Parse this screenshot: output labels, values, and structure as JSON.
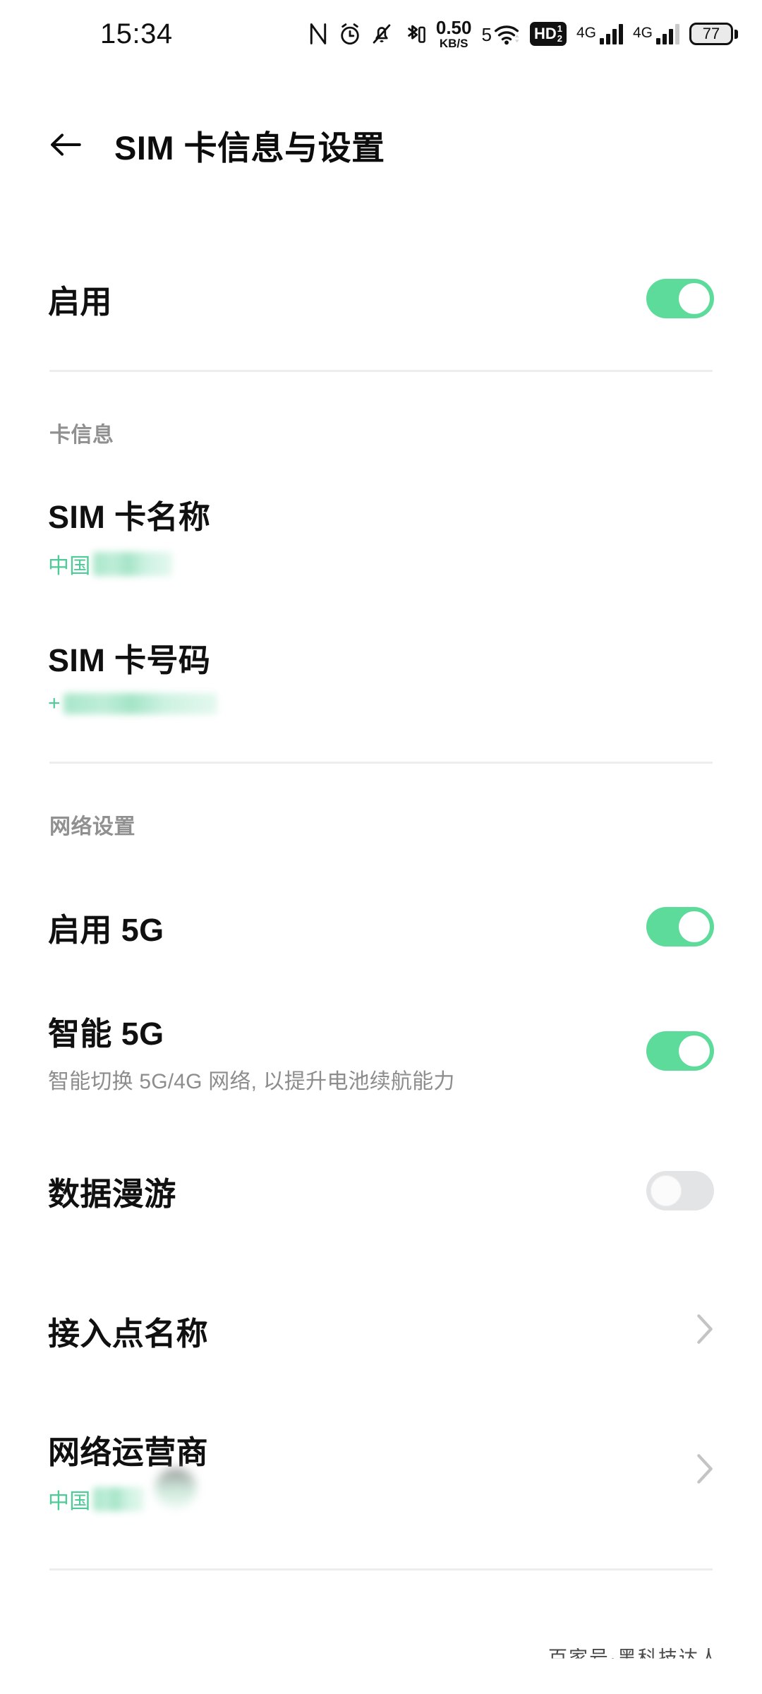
{
  "status_bar": {
    "time": "15:34",
    "icons": [
      "nfc-icon",
      "alarm-icon",
      "bell-off-icon",
      "bluetooth-icon"
    ],
    "net_speed_value": "0.50",
    "net_speed_unit": "KB/S",
    "wifi_label": "5",
    "volte_badge": "HD",
    "volte_sup": "1",
    "volte_sub": "2",
    "sim1_network": "4G",
    "sim2_network": "4G",
    "battery_level": "77"
  },
  "app_bar": {
    "back_icon": "arrow-left-icon",
    "title": "SIM 卡信息与设置"
  },
  "enable_row": {
    "title": "启用",
    "toggle_state": "on"
  },
  "card_info": {
    "section_label": "卡信息",
    "sim_name": {
      "title": "SIM 卡名称",
      "value_prefix": "中国",
      "value_redacted": true
    },
    "sim_number": {
      "title": "SIM 卡号码",
      "value_prefix": "+",
      "value_redacted": true
    }
  },
  "network_settings": {
    "section_label": "网络设置",
    "enable_5g": {
      "title": "启用 5G",
      "toggle_state": "on"
    },
    "smart_5g": {
      "title": "智能 5G",
      "subtitle": "智能切换 5G/4G 网络, 以提升电池续航能力",
      "toggle_state": "on"
    },
    "data_roaming": {
      "title": "数据漫游",
      "toggle_state": "off"
    },
    "apn": {
      "title": "接入点名称",
      "chevron_icon": "chevron-right-icon"
    },
    "carrier": {
      "title": "网络运营商",
      "value_prefix": "中国",
      "value_redacted": true,
      "chevron_icon": "chevron-right-icon"
    }
  },
  "watermark": {
    "text": "百家号·黑科技达人"
  },
  "colors": {
    "accent_green": "#5ddb9a",
    "subtitle_green": "#4ecb97",
    "toggle_off": "#e3e4e6",
    "divider": "#ededed",
    "section_label": "#909090",
    "title": "#101010",
    "subtitle_gray": "#8d8d8d"
  }
}
